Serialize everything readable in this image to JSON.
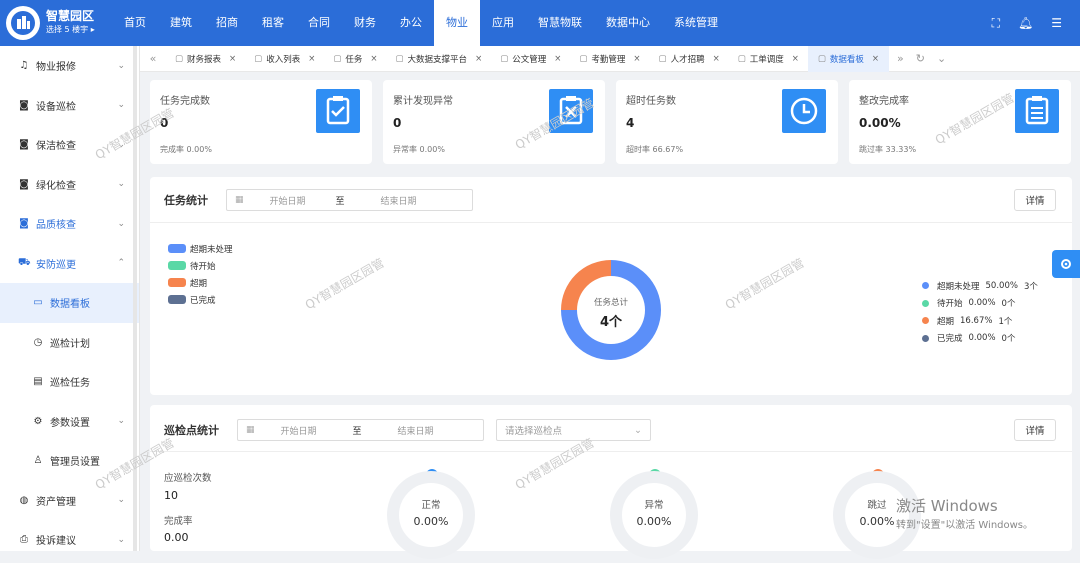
{
  "app": {
    "title": "智慧园区",
    "subtitle": "选择 5 楼宇 ▸"
  },
  "nav": [
    "首页",
    "建筑",
    "招商",
    "租客",
    "合同",
    "财务",
    "办公",
    "物业",
    "应用",
    "智慧物联",
    "数据中心",
    "系统管理"
  ],
  "nav_active": "物业",
  "sidebar": [
    {
      "label": "物业报修",
      "icon": "bell-icon",
      "chevron": "⌄"
    },
    {
      "label": "设备巡检",
      "icon": "camera-icon",
      "chevron": "⌄"
    },
    {
      "label": "保洁检查",
      "icon": "camera-icon",
      "chevron": "⌄"
    },
    {
      "label": "绿化检查",
      "icon": "camera-icon",
      "chevron": "⌄"
    },
    {
      "label": "品质核查",
      "icon": "camera-icon",
      "chevron": "⌄"
    },
    {
      "label": "安防巡更",
      "icon": "car-icon",
      "chevron": "⌃"
    },
    {
      "label": "数据看板",
      "icon": "monitor-icon",
      "chevron": ""
    },
    {
      "label": "巡检计划",
      "icon": "clock-icon",
      "chevron": ""
    },
    {
      "label": "巡检任务",
      "icon": "briefcase-icon",
      "chevron": ""
    },
    {
      "label": "参数设置",
      "icon": "gear-icon",
      "chevron": "⌄"
    },
    {
      "label": "管理员设置",
      "icon": "user-icon",
      "chevron": ""
    },
    {
      "label": "资产管理",
      "icon": "globe-icon",
      "chevron": "⌄"
    },
    {
      "label": "投诉建议",
      "icon": "printer-icon",
      "chevron": "⌄"
    }
  ],
  "tabs": [
    "财务报表",
    "收入列表",
    "任务",
    "大数据支撑平台",
    "公文管理",
    "考勤管理",
    "人才招聘",
    "工单调度",
    "数据看板"
  ],
  "kpis": [
    {
      "label": "任务完成数",
      "value": "0",
      "sub": "完成率 0.00%",
      "icon": "clipboard-check-icon"
    },
    {
      "label": "累计发现异常",
      "value": "0",
      "sub": "异常率 0.00%",
      "icon": "clipboard-x-icon"
    },
    {
      "label": "超时任务数",
      "value": "4",
      "sub": "超时率 66.67%",
      "icon": "clock-icon"
    },
    {
      "label": "整改完成率",
      "value": "0.00%",
      "sub": "跳过率 33.33%",
      "icon": "clipboard-list-icon"
    }
  ],
  "task_stats": {
    "title": "任务统计",
    "start_placeholder": "开始日期",
    "to": "至",
    "end_placeholder": "结束日期",
    "detail": "详情",
    "center_label": "任务总计",
    "center_value": "4个"
  },
  "chart_data": {
    "type": "pie",
    "categories": [
      "超期未处理",
      "待开始",
      "超期",
      "已完成"
    ],
    "values": [
      3,
      0,
      1,
      0
    ],
    "percentages": [
      "50.00%",
      "0.00%",
      "16.67%",
      "0.00%"
    ],
    "counts": [
      "3个",
      "0个",
      "1个",
      "0个"
    ],
    "colors": [
      "#5b8ff9",
      "#5ad8a6",
      "#f6844e",
      "#5d7092"
    ],
    "center_label": "任务总计",
    "center_value": "4个"
  },
  "patrol_stats": {
    "title": "巡检点统计",
    "start_placeholder": "开始日期",
    "to": "至",
    "end_placeholder": "结束日期",
    "select_placeholder": "请选择巡检点",
    "detail": "详情",
    "should_label": "应巡检次数",
    "should_value": "10",
    "rate_label": "完成率",
    "rate_value": "0.00",
    "rings": [
      {
        "label": "正常",
        "value": "0.00%",
        "color": "#2f8ef4"
      },
      {
        "label": "异常",
        "value": "0.00%",
        "color": "#5ad8a6"
      },
      {
        "label": "跳过",
        "value": "0.00%",
        "color": "#f6844e"
      }
    ]
  },
  "watermark": "QY智慧园区园管",
  "activation": {
    "line1": "激活 Windows",
    "line2": "转到\"设置\"以激活 Windows。"
  }
}
